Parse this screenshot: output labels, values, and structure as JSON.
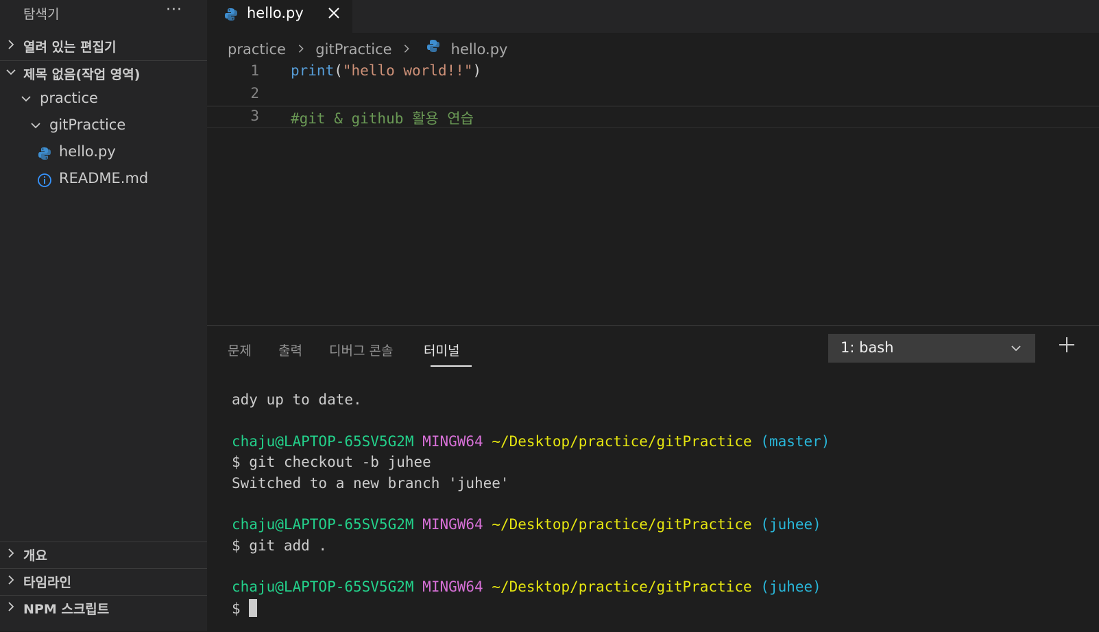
{
  "sidebar": {
    "title": "탐색기",
    "more": "···",
    "open_editors": "열려 있는 편집기",
    "workspace": "제목 없음(작업 영역)",
    "tree": {
      "folder1": "practice",
      "folder2": "gitPractice",
      "file1": "hello.py",
      "file2": "README.md"
    },
    "outline": "개요",
    "timeline": "타임라인",
    "npm": "NPM 스크립트"
  },
  "editor": {
    "tab_label": "hello.py",
    "breadcrumb": [
      "practice",
      "gitPractice",
      "hello.py"
    ],
    "lines": [
      {
        "num": "1",
        "fn": "print",
        "open": "(",
        "str": "\"hello world!!\"",
        "close": ")"
      },
      {
        "num": "2"
      },
      {
        "num": "3",
        "comment": "#git & github 활용 연습"
      }
    ]
  },
  "panel": {
    "tabs": [
      "문제",
      "출력",
      "디버그 콘솔",
      "터미널"
    ],
    "terminal_select": "1: bash",
    "terminal": {
      "line1": "ady up to date.",
      "prompt_user": "chaju@LAPTOP-65SV5G2M",
      "prompt_sys": "MINGW64",
      "prompt_path": "~/Desktop/practice/gitPractice",
      "branch_master": "(master)",
      "cmd1": "$ git checkout -b juhee",
      "out1": "Switched to a new branch 'juhee'",
      "branch_juhee": "(juhee)",
      "cmd2": "$ git add .",
      "prompt_dollar": "$ "
    }
  },
  "colors": {
    "python_icon": "#3e8ed0",
    "info_icon": "#3794ff",
    "terminal_user": "#23d18b",
    "terminal_system": "#d670d6",
    "terminal_path": "#e5e510",
    "terminal_branch": "#29b8db"
  }
}
